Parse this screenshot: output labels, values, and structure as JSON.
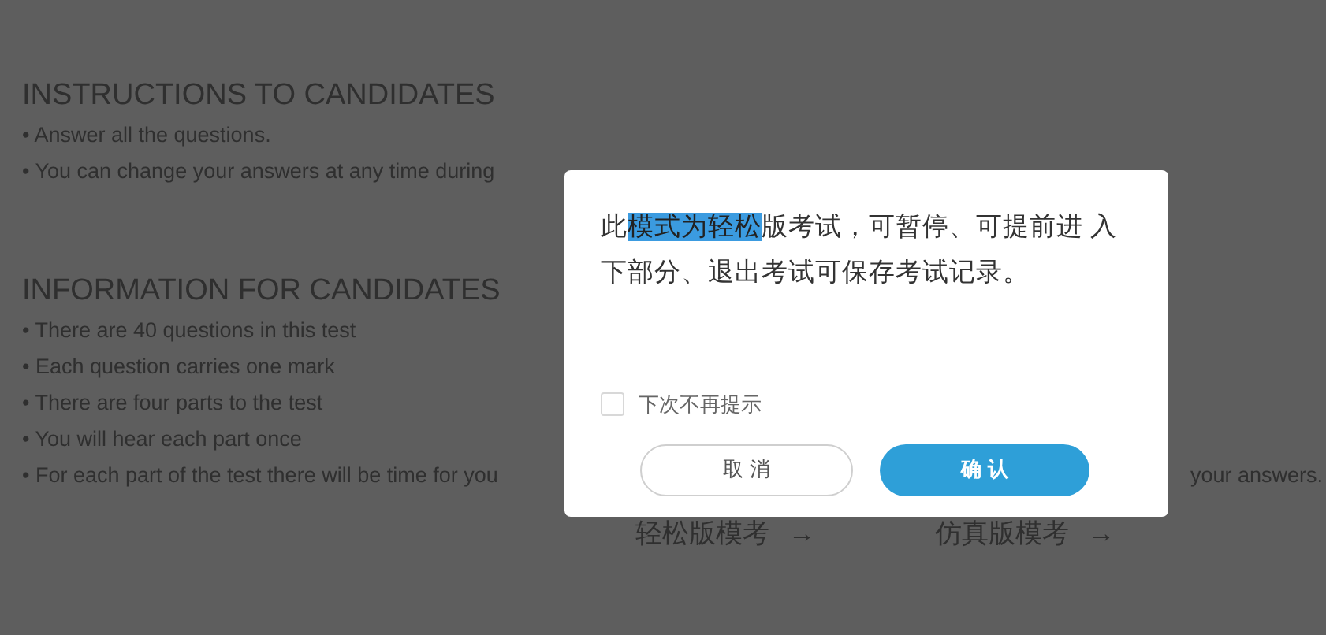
{
  "instructions": {
    "heading": "INSTRUCTIONS TO CANDIDATES",
    "items": [
      "• Answer all the questions.",
      "• You can change your answers at any time during"
    ]
  },
  "information": {
    "heading": "INFORMATION FOR CANDIDATES",
    "items": [
      "• There are 40 questions in this test",
      "• Each question carries one mark",
      "• There are four parts to the test",
      "• You will hear each part once",
      "• For each part of the test there will be time for you"
    ],
    "trailing_fragment": "your answers."
  },
  "mode_links": [
    {
      "label": "轻松版模考",
      "arrow": "→"
    },
    {
      "label": "仿真版模考",
      "arrow": "→"
    }
  ],
  "dialog": {
    "message": [
      {
        "text": "此",
        "selected": false
      },
      {
        "text": "模式为轻松",
        "selected": true
      },
      {
        "text": "版考试，可暂停、可提前进 入下部分、退出考试可保存考试记录。",
        "selected": false
      }
    ],
    "dont_show_again": {
      "label": "下次不再提示",
      "checked": false
    },
    "buttons": [
      {
        "label": "取 消",
        "kind": "secondary"
      },
      {
        "label": "确 认",
        "kind": "primary"
      }
    ]
  }
}
